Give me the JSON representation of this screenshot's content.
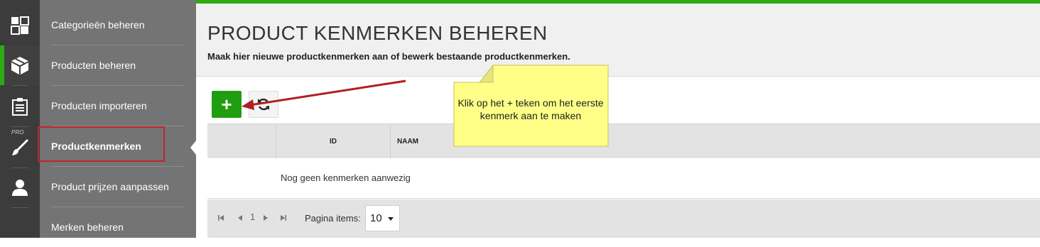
{
  "rail": {
    "items": [
      {
        "icon": "dashboard-icon"
      },
      {
        "icon": "box-icon"
      },
      {
        "icon": "clipboard-icon"
      },
      {
        "icon": "paintbrush-icon",
        "tag": "PRO"
      },
      {
        "icon": "user-icon"
      }
    ]
  },
  "subnav": {
    "items": [
      {
        "label": "Categorieën beheren"
      },
      {
        "label": "Producten beheren"
      },
      {
        "label": "Producten importeren"
      },
      {
        "label": "Productkenmerken"
      },
      {
        "label": "Product prijzen aanpassen"
      },
      {
        "label": "Merken beheren"
      }
    ]
  },
  "header": {
    "title": "PRODUCT KENMERKEN BEHEREN",
    "subtitle": "Maak hier nieuwe productkenmerken aan of bewerk bestaande productkenmerken."
  },
  "toolbar": {
    "add_label": "+",
    "refresh_icon": "refresh-icon"
  },
  "grid": {
    "columns": [
      "ID",
      "NAAM"
    ],
    "empty_message": "Nog geen kenmerken aanwezig"
  },
  "pager": {
    "current_page": "1",
    "items_label": "Pagina items:",
    "page_size": "10"
  },
  "callout": {
    "text": "Klik op het + teken om het eerste kenmerk aan te maken"
  },
  "colors": {
    "accent": "#2eaa12",
    "rail_bg": "#3c3c3c",
    "subnav_bg": "#747474",
    "highlight_box": "#c0262a",
    "callout_bg": "#ffff88",
    "arrow": "#b01e22"
  }
}
